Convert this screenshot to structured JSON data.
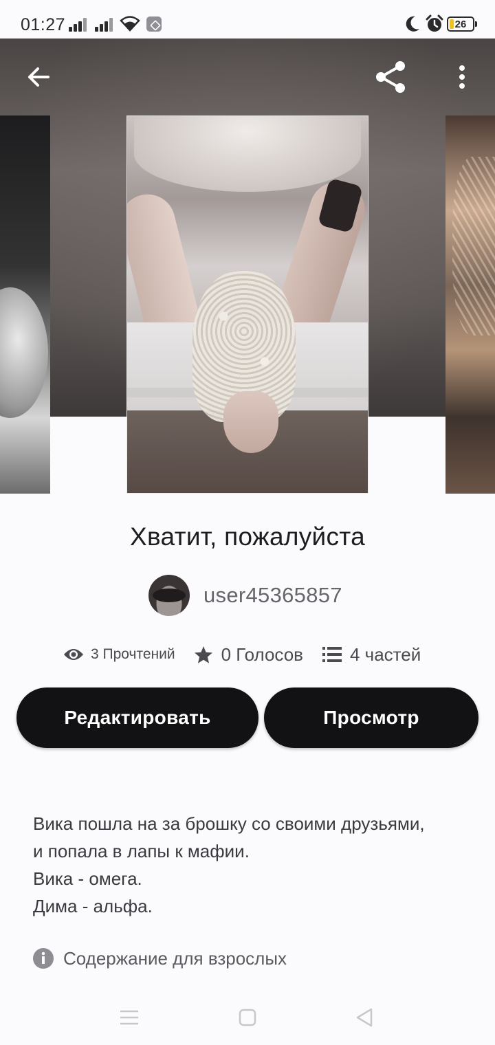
{
  "status_bar": {
    "time": "01:27",
    "battery_level": "26",
    "icons": [
      "signal-icon",
      "signal-icon",
      "wifi-icon",
      "app-notification-icon",
      "do-not-disturb-moon-icon",
      "alarm-icon",
      "battery-icon"
    ]
  },
  "app_bar": {
    "icons": [
      "back-arrow-icon",
      "share-icon",
      "more-vertical-icon"
    ]
  },
  "story": {
    "title": "Хватит, пожалуйста",
    "author": "user45365857",
    "stats": {
      "reads": "3 Прочтений",
      "votes": "0 Голосов",
      "parts": "4 частей"
    },
    "buttons": {
      "edit": "Редактировать",
      "preview": "Просмотр"
    },
    "description": [
      "Вика пошла на за брошку со своими друзьями,",
      "и попала в лапы к мафии.",
      "Вика - омега.",
      "Дима - альфа."
    ],
    "mature_label": "Содержание для взрослых"
  },
  "nav_bar": {
    "icons": [
      "recents-menu-icon",
      "home-square-icon",
      "back-triangle-icon"
    ]
  },
  "colors": {
    "background": "#fbfafc",
    "button": "#121113",
    "button_text": "#ffffff",
    "text_primary": "#1d1c1e",
    "text_secondary": "#66656a"
  }
}
